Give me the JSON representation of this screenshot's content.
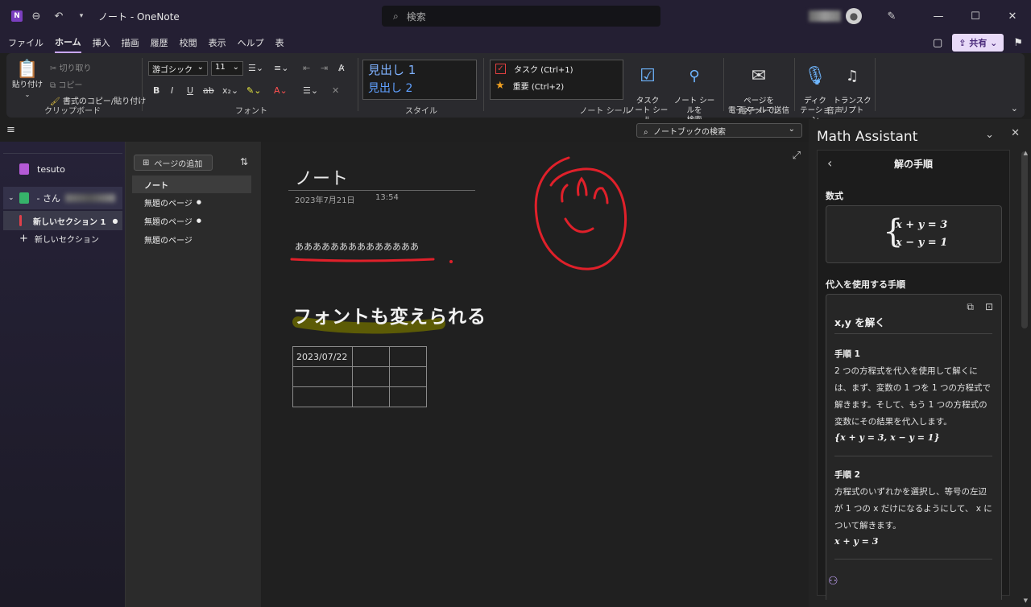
{
  "window": {
    "title": "ノート - OneNote",
    "search_placeholder": "検索"
  },
  "menu": {
    "items": [
      "ファイル",
      "ホーム",
      "挿入",
      "描画",
      "履歴",
      "校閲",
      "表示",
      "ヘルプ",
      "表"
    ],
    "active": "ホーム",
    "share_label": "共有"
  },
  "ribbon": {
    "clipboard": {
      "paste": "貼り付け",
      "cut": "切り取り",
      "copy": "コピー",
      "format_painter": "書式のコピー/貼り付け",
      "label": "クリップボード"
    },
    "font": {
      "family": "游ゴシック",
      "size": "11",
      "label": "フォント"
    },
    "styles": {
      "h1": "見出し 1",
      "h2": "見出し 2",
      "label": "スタイル"
    },
    "tags": {
      "task": "タスク (Ctrl+1)",
      "important": "重要 (Ctrl+2)",
      "todo_tag": "タスク\nノート シール",
      "find_tags": "ノート シールを\n検索",
      "label": "ノート シール"
    },
    "email": {
      "button": "ページを\n電子メールで送信",
      "label": "電子メール"
    },
    "voice": {
      "dictate": "ディク\nテーション",
      "transcribe": "トランスク\nリプト",
      "label": "音声"
    }
  },
  "notebook_search": "ノートブックの検索",
  "notebooks": [
    {
      "name": "tesuto",
      "color": "#b45ad6"
    },
    {
      "name": "- さん",
      "color": "#36b36a"
    }
  ],
  "sections": [
    {
      "name": "新しいセクション 1",
      "color": "#e0404a"
    },
    {
      "name": "新しいセクション",
      "add": true
    }
  ],
  "pages": {
    "add_label": "ページの追加",
    "items": [
      {
        "title": "ノート",
        "active": true
      },
      {
        "title": "無題のページ",
        "dot": true
      },
      {
        "title": "無題のページ",
        "dot": true
      },
      {
        "title": "無題のページ"
      }
    ]
  },
  "note": {
    "title": "ノート",
    "date": "2023年7月21日",
    "time": "13:54",
    "text": "ああああああああああああああ",
    "handwriting": "フォントも変えられる",
    "table": [
      [
        "2023/07/22",
        "",
        ""
      ],
      [
        "",
        "",
        ""
      ],
      [
        "",
        "",
        ""
      ]
    ]
  },
  "math": {
    "title": "Math Assistant",
    "header": "解の手順",
    "formula_label": "数式",
    "eq1": "x + y = 3",
    "eq2": "x − y = 1",
    "method_label": "代入を使用する手順",
    "solve_title": "x,y を解く",
    "steps": [
      {
        "title": "手順 1",
        "lines": [
          "2 つの方程式を代入を使用して解くに",
          "は、まず、変数の 1 つを 1 つの方程式で",
          "解きます。そして、もう 1 つの方程式の",
          "変数にその結果を代入します。"
        ],
        "math": "{x + y = 3, x − y = 1}"
      },
      {
        "title": "手順 2",
        "lines": [
          "方程式のいずれかを選択し、等号の左辺",
          "が 1 つの x だけになるようにして、 x に",
          "ついて解きます。"
        ],
        "math": "x + y = 3"
      }
    ]
  },
  "colors": {
    "accent": "#c9a7ff",
    "ink_red": "#e0202a",
    "highlight": "#7a7a00"
  }
}
